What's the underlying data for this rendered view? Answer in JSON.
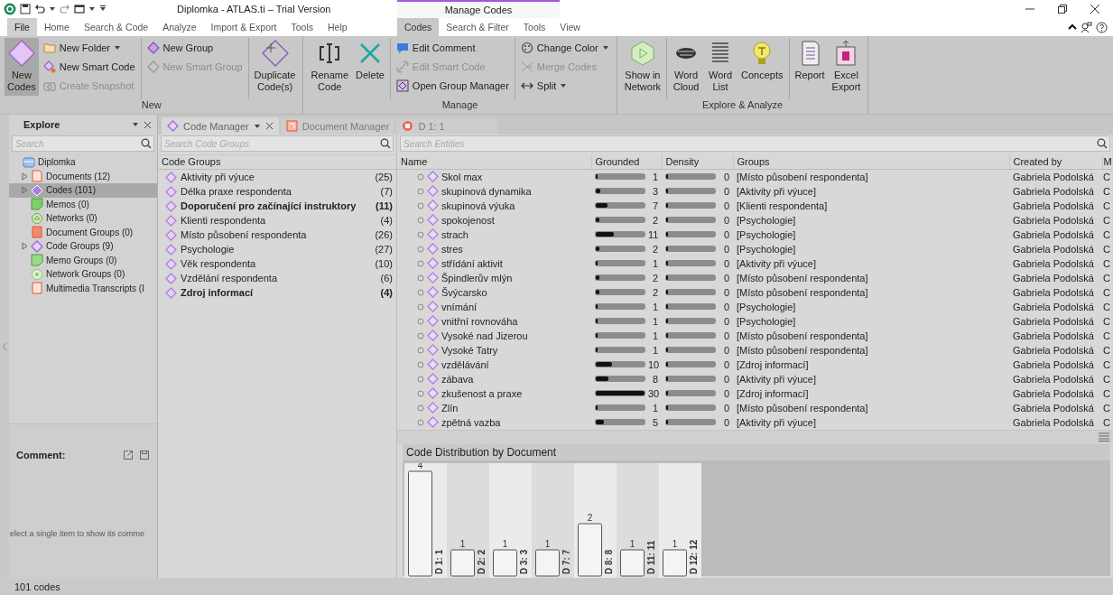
{
  "window": {
    "title": "Diplomka - ATLAS.ti – Trial Version"
  },
  "ribbon_tabs": [
    {
      "label": "File",
      "selected": false,
      "kind": "file"
    },
    {
      "label": "Home",
      "selected": false,
      "kind": "normal"
    },
    {
      "label": "Search & Code",
      "selected": false,
      "kind": "normal"
    },
    {
      "label": "Analyze",
      "selected": false,
      "kind": "normal"
    },
    {
      "label": "Import & Export",
      "selected": false,
      "kind": "normal"
    },
    {
      "label": "Tools",
      "selected": false,
      "kind": "normal"
    },
    {
      "label": "Help",
      "selected": false,
      "kind": "normal"
    }
  ],
  "context_tabs": {
    "heading": "Manage Codes",
    "tabs": [
      {
        "label": "Codes",
        "selected": true
      },
      {
        "label": "Search & Filter",
        "selected": false
      },
      {
        "label": "Tools",
        "selected": false
      },
      {
        "label": "View",
        "selected": false
      }
    ]
  },
  "ribbon_groups": [
    {
      "label": "New",
      "sections": [
        [
          {
            "kind": "large",
            "items": [
              {
                "label": "New\nCodes",
                "pressed": true,
                "disabled": false,
                "dropdown": false
              }
            ]
          },
          {
            "kind": "small",
            "items": [
              {
                "label": "New Folder",
                "disabled": false,
                "dropdown": true
              },
              {
                "label": "New Smart Code",
                "disabled": false,
                "dropdown": false
              },
              {
                "label": "Create Snapshot",
                "disabled": true,
                "dropdown": false
              }
            ]
          }
        ],
        [
          {
            "kind": "small",
            "items": [
              {
                "label": "New Group",
                "disabled": false,
                "dropdown": false
              },
              {
                "label": "New Smart Group",
                "disabled": true,
                "dropdown": false
              }
            ]
          }
        ],
        [
          {
            "kind": "large",
            "items": [
              {
                "label": "Duplicate\nCode(s)",
                "pressed": false,
                "disabled": false,
                "dropdown": false
              }
            ]
          }
        ]
      ]
    },
    {
      "label": "Manage",
      "sections": [
        [
          {
            "kind": "large",
            "items": [
              {
                "label": "Rename\nCode",
                "pressed": false,
                "disabled": false,
                "dropdown": false
              },
              {
                "label": "Delete",
                "pressed": false,
                "disabled": false,
                "dropdown": false
              }
            ]
          }
        ],
        [
          {
            "kind": "small",
            "items": [
              {
                "label": "Edit Comment",
                "disabled": false,
                "dropdown": false
              },
              {
                "label": "Edit Smart Code",
                "disabled": true,
                "dropdown": false
              },
              {
                "label": "Open Group Manager",
                "disabled": false,
                "dropdown": false
              }
            ]
          }
        ],
        [
          {
            "kind": "small",
            "items": [
              {
                "label": "Change Color",
                "disabled": false,
                "dropdown": true
              },
              {
                "label": "Merge Codes",
                "disabled": true,
                "dropdown": false
              },
              {
                "label": "Split",
                "disabled": false,
                "dropdown": true
              }
            ]
          }
        ]
      ]
    },
    {
      "label": "Explore & Analyze",
      "sections": [
        [
          {
            "kind": "large",
            "items": [
              {
                "label": "Show in\nNetwork",
                "pressed": false,
                "disabled": false,
                "dropdown": false
              }
            ]
          }
        ],
        [
          {
            "kind": "large",
            "items": [
              {
                "label": "Word\nCloud",
                "pressed": false,
                "disabled": false,
                "dropdown": false
              },
              {
                "label": "Word\nList",
                "pressed": false,
                "disabled": false,
                "dropdown": false
              },
              {
                "label": "Concepts",
                "pressed": false,
                "disabled": false,
                "dropdown": false
              }
            ]
          }
        ],
        [
          {
            "kind": "large",
            "items": [
              {
                "label": "Report",
                "pressed": false,
                "disabled": false,
                "dropdown": false
              },
              {
                "label": "Excel\nExport",
                "pressed": false,
                "disabled": false,
                "dropdown": false
              }
            ]
          }
        ]
      ]
    }
  ],
  "explore": {
    "title": "Explore",
    "search_placeholder": "Search",
    "tree": [
      {
        "label": "Diplomka",
        "kind": "project",
        "expander": false,
        "selected": false,
        "children": [
          {
            "label": "Documents (12)",
            "kind": "document",
            "expander": true,
            "selected": false
          },
          {
            "label": "Codes (101)",
            "kind": "code",
            "expander": true,
            "selected": true
          },
          {
            "label": "Memos (0)",
            "kind": "memo",
            "expander": false,
            "selected": false
          },
          {
            "label": "Networks (0)",
            "kind": "network",
            "expander": false,
            "selected": false
          },
          {
            "label": "Document Groups (0)",
            "kind": "document-group",
            "expander": false,
            "selected": false
          },
          {
            "label": "Code Groups (9)",
            "kind": "code-group",
            "expander": true,
            "selected": false
          },
          {
            "label": "Memo Groups (0)",
            "kind": "memo-group",
            "expander": false,
            "selected": false
          },
          {
            "label": "Network Groups (0)",
            "kind": "network-group",
            "expander": false,
            "selected": false
          },
          {
            "label": "Multimedia Transcripts (I",
            "kind": "transcript",
            "expander": false,
            "selected": false
          }
        ]
      }
    ]
  },
  "comment": {
    "title": "Comment:",
    "text": "elect a single item to show its comme"
  },
  "document_tabs": [
    {
      "label": "Code Manager",
      "kind": "code-manager",
      "selected": true
    },
    {
      "label": "Document Manager",
      "kind": "document-manager",
      "selected": false
    },
    {
      "label": "D 1: 1",
      "kind": "document",
      "selected": false
    }
  ],
  "code_groups": {
    "search_placeholder": "Search Code Groups",
    "header": "Code Groups",
    "items": [
      {
        "name": "Aktivity při výuce",
        "count": "(25)",
        "bold": false
      },
      {
        "name": "Délka praxe respondenta",
        "count": "(7)",
        "bold": false
      },
      {
        "name": "Doporučení pro začínající instruktory",
        "count": "(11)",
        "bold": true
      },
      {
        "name": "Klienti respondenta",
        "count": "(4)",
        "bold": false
      },
      {
        "name": "Místo působení respondenta",
        "count": "(26)",
        "bold": false
      },
      {
        "name": "Psychologie",
        "count": "(27)",
        "bold": false
      },
      {
        "name": "Věk respondenta",
        "count": "(10)",
        "bold": false
      },
      {
        "name": "Vzdělání respondenta",
        "count": "(6)",
        "bold": false
      },
      {
        "name": "Zdroj informací",
        "count": "(4)",
        "bold": true
      }
    ]
  },
  "entities": {
    "search_placeholder": "Search Entities",
    "columns": [
      "Name",
      "Grounded",
      "Density",
      "Groups",
      "Created by",
      "M"
    ],
    "rows": [
      {
        "name": "Skol max",
        "grounded": {
          "value": "1",
          "level": 0.033
        },
        "density": {
          "value": "0",
          "level": 0
        },
        "groups": "[Místo působení respondenta]",
        "created_by": "Gabriela Podolská",
        "column_6": "C"
      },
      {
        "name": "skupinová dynamika",
        "grounded": {
          "value": "3",
          "level": 0.1
        },
        "density": {
          "value": "0",
          "level": 0
        },
        "groups": "[Aktivity při výuce]",
        "created_by": "Gabriela Podolská",
        "column_6": "C"
      },
      {
        "name": "skupinová výuka",
        "grounded": {
          "value": "7",
          "level": 0.233
        },
        "density": {
          "value": "0",
          "level": 0
        },
        "groups": "[Klienti respondenta]",
        "created_by": "Gabriela Podolská",
        "column_6": "C"
      },
      {
        "name": "spokojenost",
        "grounded": {
          "value": "2",
          "level": 0.067
        },
        "density": {
          "value": "0",
          "level": 0
        },
        "groups": "[Psychologie]",
        "created_by": "Gabriela Podolská",
        "column_6": "C"
      },
      {
        "name": "strach",
        "grounded": {
          "value": "11",
          "level": 0.367
        },
        "density": {
          "value": "0",
          "level": 0
        },
        "groups": "[Psychologie]",
        "created_by": "Gabriela Podolská",
        "column_6": "C"
      },
      {
        "name": "stres",
        "grounded": {
          "value": "2",
          "level": 0.067
        },
        "density": {
          "value": "0",
          "level": 0
        },
        "groups": "[Psychologie]",
        "created_by": "Gabriela Podolská",
        "column_6": "C"
      },
      {
        "name": "střídání aktivit",
        "grounded": {
          "value": "1",
          "level": 0.033
        },
        "density": {
          "value": "0",
          "level": 0
        },
        "groups": "[Aktivity při výuce]",
        "created_by": "Gabriela Podolská",
        "column_6": "C"
      },
      {
        "name": "Špindlerův mlýn",
        "grounded": {
          "value": "2",
          "level": 0.067
        },
        "density": {
          "value": "0",
          "level": 0
        },
        "groups": "[Místo působení respondenta]",
        "created_by": "Gabriela Podolská",
        "column_6": "C"
      },
      {
        "name": "Švýcarsko",
        "grounded": {
          "value": "2",
          "level": 0.067
        },
        "density": {
          "value": "0",
          "level": 0
        },
        "groups": "[Místo působení respondenta]",
        "created_by": "Gabriela Podolská",
        "column_6": "C"
      },
      {
        "name": "vnímání",
        "grounded": {
          "value": "1",
          "level": 0.033
        },
        "density": {
          "value": "0",
          "level": 0
        },
        "groups": "[Psychologie]",
        "created_by": "Gabriela Podolská",
        "column_6": "C"
      },
      {
        "name": "vnitřní rovnováha",
        "grounded": {
          "value": "1",
          "level": 0.033
        },
        "density": {
          "value": "0",
          "level": 0
        },
        "groups": "[Psychologie]",
        "created_by": "Gabriela Podolská",
        "column_6": "C"
      },
      {
        "name": "Vysoké nad Jizerou",
        "grounded": {
          "value": "1",
          "level": 0.033
        },
        "density": {
          "value": "0",
          "level": 0
        },
        "groups": "[Místo působení respondenta]",
        "created_by": "Gabriela Podolská",
        "column_6": "C"
      },
      {
        "name": "Vysoké Tatry",
        "grounded": {
          "value": "1",
          "level": 0.033
        },
        "density": {
          "value": "0",
          "level": 0
        },
        "groups": "[Místo působení respondenta]",
        "created_by": "Gabriela Podolská",
        "column_6": "C"
      },
      {
        "name": "vzdělávání",
        "grounded": {
          "value": "10",
          "level": 0.333
        },
        "density": {
          "value": "0",
          "level": 0
        },
        "groups": "[Zdroj informací]",
        "created_by": "Gabriela Podolská",
        "column_6": "C"
      },
      {
        "name": "zábava",
        "grounded": {
          "value": "8",
          "level": 0.267
        },
        "density": {
          "value": "0",
          "level": 0
        },
        "groups": "[Aktivity při výuce]",
        "created_by": "Gabriela Podolská",
        "column_6": "C"
      },
      {
        "name": "zkušenost a praxe",
        "grounded": {
          "value": "30",
          "level": 1
        },
        "density": {
          "value": "0",
          "level": 0
        },
        "groups": "[Zdroj informací]",
        "created_by": "Gabriela Podolská",
        "column_6": "C"
      },
      {
        "name": "Zlín",
        "grounded": {
          "value": "1",
          "level": 0.033
        },
        "density": {
          "value": "0",
          "level": 0
        },
        "groups": "[Místo působení respondenta]",
        "created_by": "Gabriela Podolská",
        "column_6": "C"
      },
      {
        "name": "zpětná vazba",
        "grounded": {
          "value": "5",
          "level": 0.167
        },
        "density": {
          "value": "0",
          "level": 0
        },
        "groups": "[Aktivity při výuce]",
        "created_by": "Gabriela Podolská",
        "column_6": "C"
      }
    ]
  },
  "chart_panel": {
    "title": "Code Distribution by Document",
    "chart_data": {
      "type": "bar",
      "categories": [
        "D 1: 1",
        "D 2: 2",
        "D 3: 3",
        "D 7: 7",
        "D 8: 8",
        "D 11: 11",
        "D 12: 12"
      ],
      "values": [
        4,
        1,
        1,
        1,
        2,
        1,
        1
      ],
      "data_labels": true
    }
  },
  "status_bar": {
    "text": "101 codes"
  }
}
